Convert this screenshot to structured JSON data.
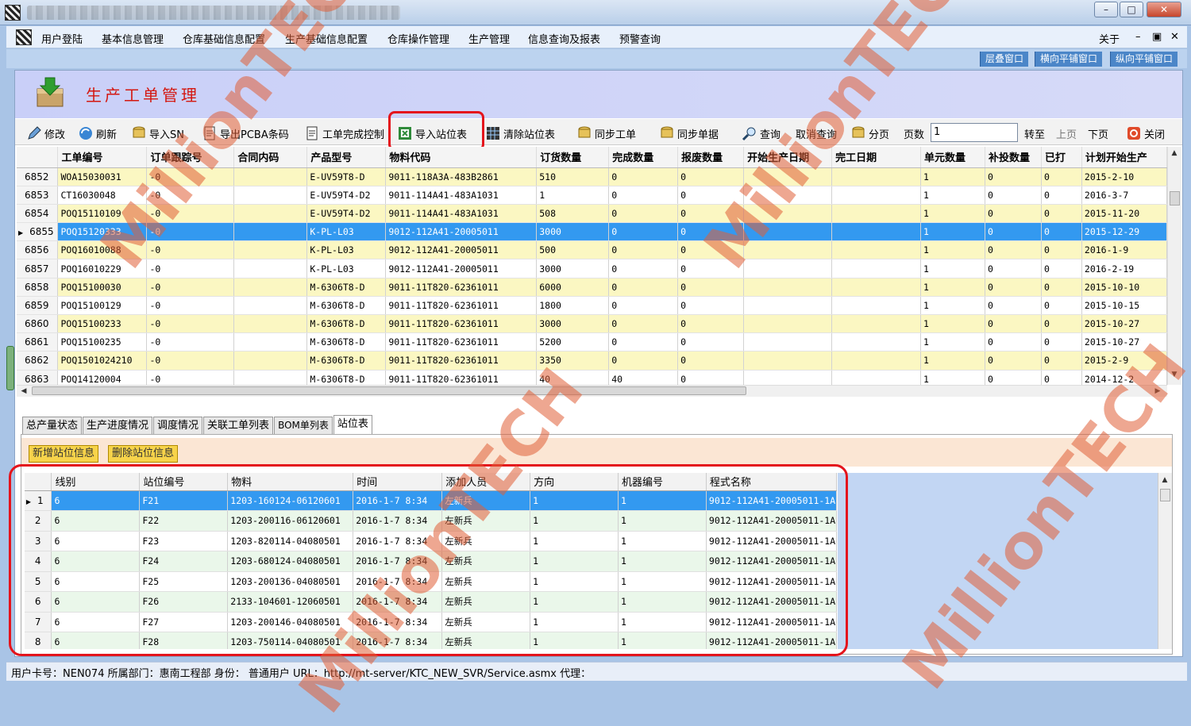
{
  "window": {
    "controls": [
      "–",
      "□",
      "✕"
    ]
  },
  "menu": [
    "用户登陆",
    "基本信息管理",
    "仓库基础信息配置",
    "生产基础信息配置",
    "仓库操作管理",
    "生产管理",
    "信息查询及报表",
    "预警查询"
  ],
  "menu_right": {
    "about": "关于",
    "min": "–",
    "restore": "▣",
    "close": "✕"
  },
  "mdi_buttons": [
    "层叠窗口",
    "横向平铺窗口",
    "纵向平铺窗口"
  ],
  "page_title": "生产工单管理",
  "toolbar": {
    "edit": "修改",
    "refresh": "刷新",
    "import_sn": "导入SN",
    "export_pcba": "导出PCBA条码",
    "wo_complete": "工单完成控制",
    "import_station": "导入站位表",
    "clear_station": "清除站位表",
    "sync_wo": "同步工单",
    "sync_doc": "同步单据",
    "query": "查询",
    "cancel_query": "取消查询",
    "paging": "分页",
    "pages_label": "页数",
    "pages_value": "1",
    "goto": "转至",
    "prev": "上页",
    "next": "下页",
    "close": "关闭"
  },
  "grid1": {
    "columns": [
      "",
      "工单编号",
      "订单跟踪号",
      "合同内码",
      "产品型号",
      "物料代码",
      "订货数量",
      "完成数量",
      "报废数量",
      "开始生产日期",
      "完工日期",
      "单元数量",
      "补投数量",
      "已打",
      "计划开始生产"
    ],
    "rows": [
      [
        "6852",
        "WOA15030031",
        "-0",
        "",
        "E-UV59T8-D",
        "9011-118A3A-483B2861",
        "510",
        "0",
        "0",
        "",
        "",
        "1",
        "0",
        "0",
        "2015-2-10"
      ],
      [
        "6853",
        "CT16030048",
        "-0",
        "",
        "E-UV59T4-D2",
        "9011-114A41-483A1031",
        "1",
        "0",
        "0",
        "",
        "",
        "1",
        "0",
        "0",
        "2016-3-7"
      ],
      [
        "6854",
        "POQ15110109",
        "-0",
        "",
        "E-UV59T4-D2",
        "9011-114A41-483A1031",
        "508",
        "0",
        "0",
        "",
        "",
        "1",
        "0",
        "0",
        "2015-11-20"
      ],
      [
        "6855",
        "POQ15120333",
        "-0",
        "",
        "K-PL-L03",
        "9012-112A41-20005011",
        "3000",
        "0",
        "0",
        "",
        "",
        "1",
        "0",
        "0",
        "2015-12-29"
      ],
      [
        "6856",
        "POQ16010088",
        "-0",
        "",
        "K-PL-L03",
        "9012-112A41-20005011",
        "500",
        "0",
        "0",
        "",
        "",
        "1",
        "0",
        "0",
        "2016-1-9"
      ],
      [
        "6857",
        "POQ16010229",
        "-0",
        "",
        "K-PL-L03",
        "9012-112A41-20005011",
        "3000",
        "0",
        "0",
        "",
        "",
        "1",
        "0",
        "0",
        "2016-2-19"
      ],
      [
        "6858",
        "POQ15100030",
        "-0",
        "",
        "M-6306T8-D",
        "9011-11T820-62361011",
        "6000",
        "0",
        "0",
        "",
        "",
        "1",
        "0",
        "0",
        "2015-10-10"
      ],
      [
        "6859",
        "POQ15100129",
        "-0",
        "",
        "M-6306T8-D",
        "9011-11T820-62361011",
        "1800",
        "0",
        "0",
        "",
        "",
        "1",
        "0",
        "0",
        "2015-10-15"
      ],
      [
        "6860",
        "POQ15100233",
        "-0",
        "",
        "M-6306T8-D",
        "9011-11T820-62361011",
        "3000",
        "0",
        "0",
        "",
        "",
        "1",
        "0",
        "0",
        "2015-10-27"
      ],
      [
        "6861",
        "POQ15100235",
        "-0",
        "",
        "M-6306T8-D",
        "9011-11T820-62361011",
        "5200",
        "0",
        "0",
        "",
        "",
        "1",
        "0",
        "0",
        "2015-10-27"
      ],
      [
        "6862",
        "POQ1501024210",
        "-0",
        "",
        "M-6306T8-D",
        "9011-11T820-62361011",
        "3350",
        "0",
        "0",
        "",
        "",
        "1",
        "0",
        "0",
        "2015-2-9"
      ],
      [
        "6863",
        "POQ14120004",
        "-0",
        "",
        "M-6306T8-D",
        "9011-11T820-62361011",
        "40",
        "40",
        "0",
        "",
        "",
        "1",
        "0",
        "0",
        "2014-12-2"
      ]
    ],
    "selected_row": 3
  },
  "tabs": [
    "总产量状态",
    "生产进度情况",
    "调度情况",
    "关联工单列表",
    "BOM单列表",
    "站位表"
  ],
  "active_tab": 5,
  "station_buttons": {
    "add": "新增站位信息",
    "delete": "删除站位信息"
  },
  "grid2": {
    "columns": [
      "",
      "线别",
      "站位编号",
      "物料",
      "时间",
      "添加人员",
      "方向",
      "机器编号",
      "程式名称"
    ],
    "rows": [
      [
        "1",
        "6",
        "F21",
        "1203-160124-06120601",
        "2016-1-7 8:34",
        "左新兵",
        "1",
        "1",
        "9012-112A41-20005011-1A"
      ],
      [
        "2",
        "6",
        "F22",
        "1203-200116-06120601",
        "2016-1-7 8:34",
        "左新兵",
        "1",
        "1",
        "9012-112A41-20005011-1A"
      ],
      [
        "3",
        "6",
        "F23",
        "1203-820114-04080501",
        "2016-1-7 8:34",
        "左新兵",
        "1",
        "1",
        "9012-112A41-20005011-1A"
      ],
      [
        "4",
        "6",
        "F24",
        "1203-680124-04080501",
        "2016-1-7 8:34",
        "左新兵",
        "1",
        "1",
        "9012-112A41-20005011-1A"
      ],
      [
        "5",
        "6",
        "F25",
        "1203-200136-04080501",
        "2016-1-7 8:34",
        "左新兵",
        "1",
        "1",
        "9012-112A41-20005011-1A"
      ],
      [
        "6",
        "6",
        "F26",
        "2133-104601-12060501",
        "2016-1-7 8:34",
        "左新兵",
        "1",
        "1",
        "9012-112A41-20005011-1A"
      ],
      [
        "7",
        "6",
        "F27",
        "1203-200146-04080501",
        "2016-1-7 8:34",
        "左新兵",
        "1",
        "1",
        "9012-112A41-20005011-1A"
      ],
      [
        "8",
        "6",
        "F28",
        "1203-750114-04080501",
        "2016-1-7 8:34",
        "左新兵",
        "1",
        "1",
        "9012-112A41-20005011-1A"
      ]
    ],
    "selected_row": 0
  },
  "status": "用户卡号：NEN074   所属部门：惠南工程部 身份：  普通用户  URL：http://mt-server/KTC_NEW_SVR/Service.asmx  代理：",
  "watermark": "MillionTECH",
  "colors": {
    "highlight_red": "#e4141c",
    "selected_row": "#3399f0",
    "title_red": "#d4170f"
  }
}
